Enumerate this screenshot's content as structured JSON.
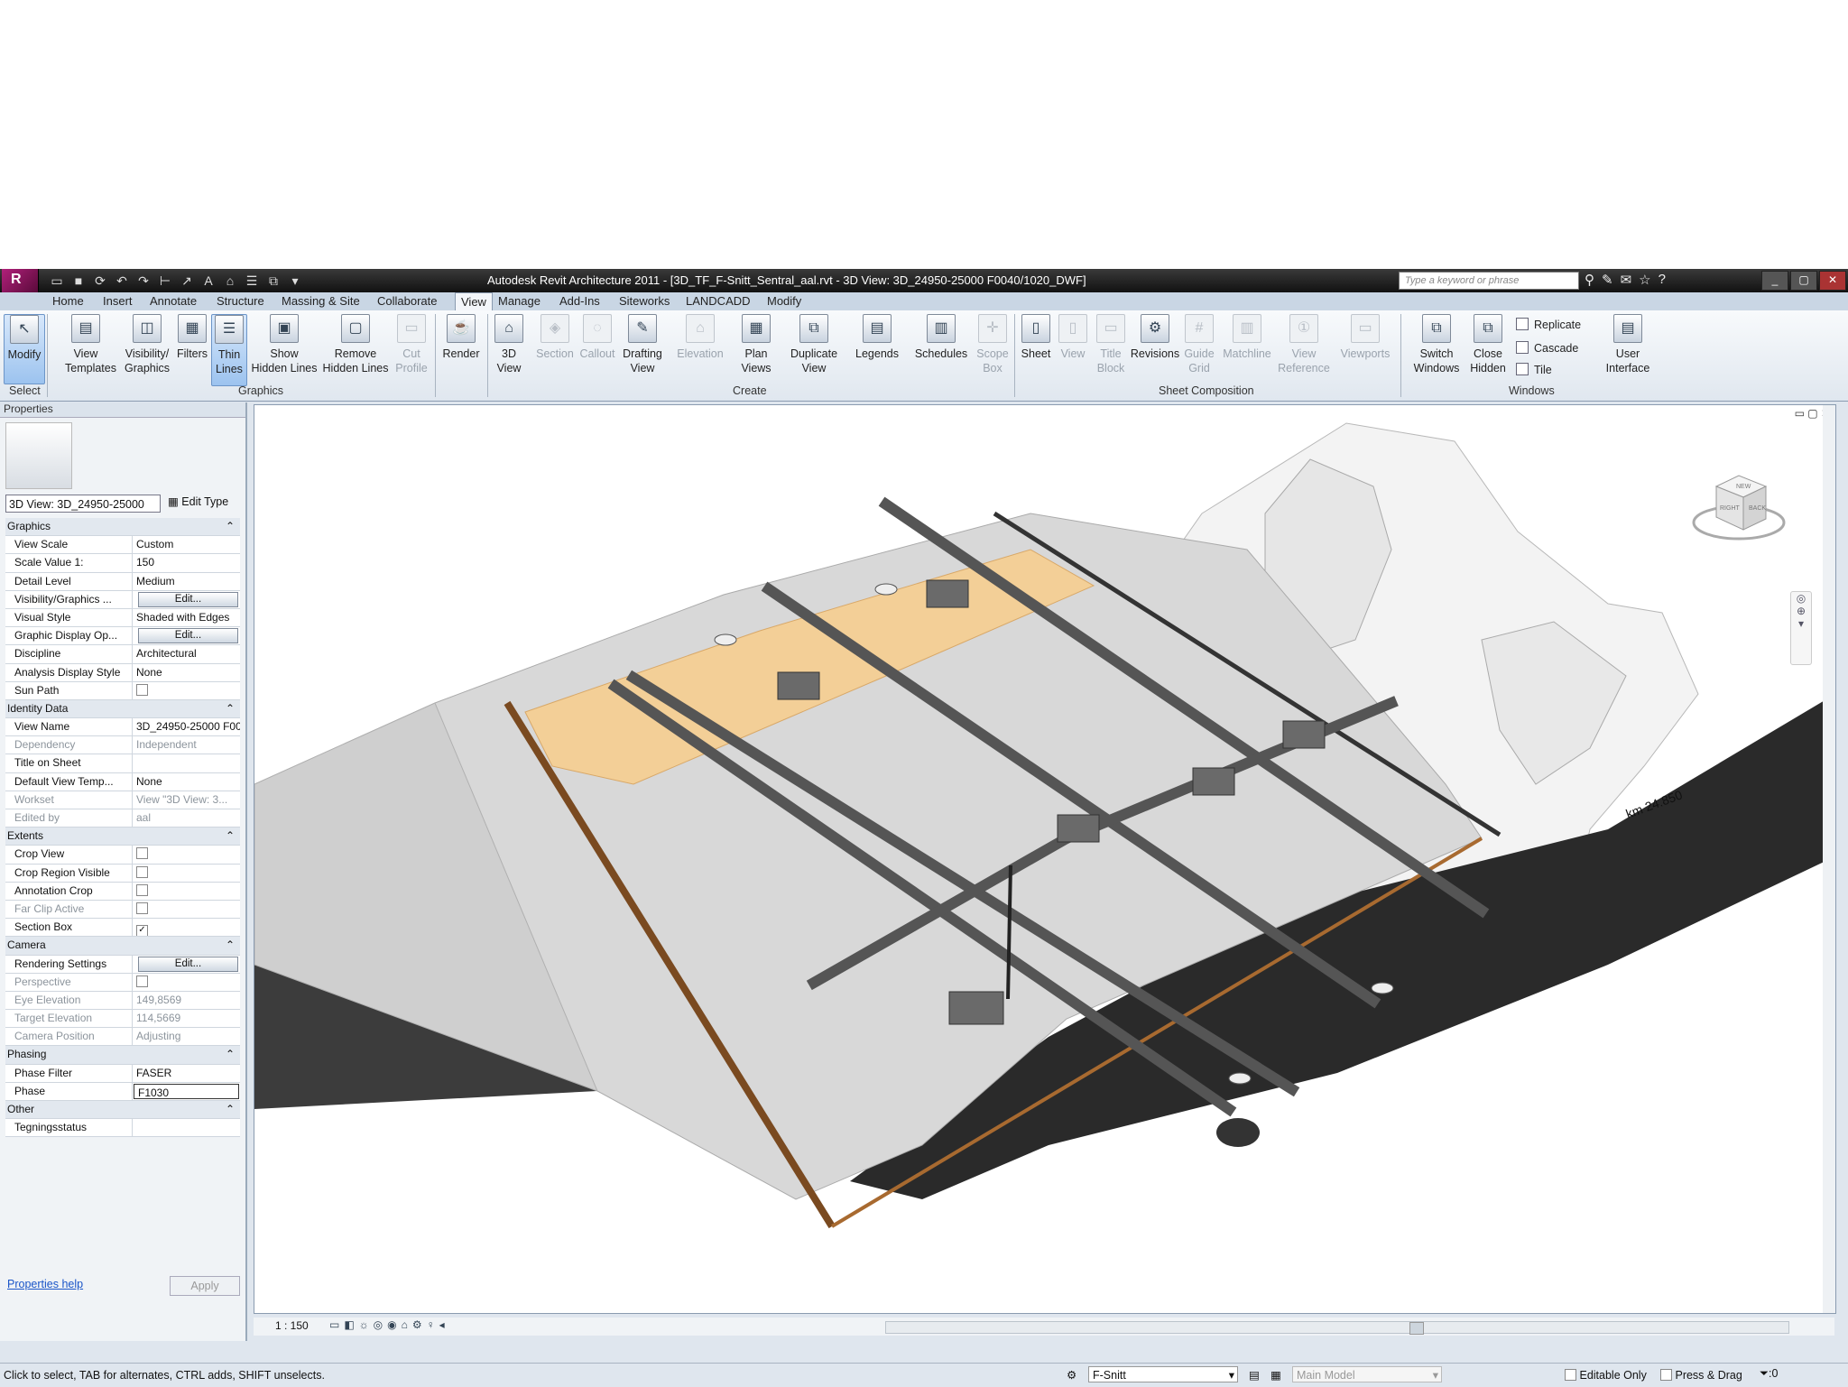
{
  "window": {
    "title": "Autodesk Revit Architecture 2011 - [3D_TF_F-Snitt_Sentral_aal.rvt - 3D View: 3D_24950-25000 F0040/1020_DWF]",
    "search_placeholder": "Type a keyword or phrase",
    "logo": "R"
  },
  "tabs": [
    "Home",
    "Insert",
    "Annotate",
    "Structure",
    "Massing & Site",
    "Collaborate",
    "View",
    "Manage",
    "Add-Ins",
    "Siteworks",
    "LANDCADD",
    "Modify"
  ],
  "active_tab": "View",
  "ribbon": {
    "modify": "Modify",
    "view_templates": [
      "View",
      "Templates"
    ],
    "visibility": [
      "Visibility/",
      "Graphics"
    ],
    "filters": "Filters",
    "thin_lines": [
      "Thin",
      "Lines"
    ],
    "show_hidden": [
      "Show",
      "Hidden Lines"
    ],
    "remove_hidden": [
      "Remove",
      "Hidden Lines"
    ],
    "cut_profile": [
      "Cut",
      "Profile"
    ],
    "render": "Render",
    "view3d": [
      "3D",
      "View"
    ],
    "section": "Section",
    "callout": "Callout",
    "drafting": [
      "Drafting",
      "View"
    ],
    "elevation": "Elevation",
    "plan_views": [
      "Plan",
      "Views"
    ],
    "duplicate": [
      "Duplicate",
      "View"
    ],
    "legends": "Legends",
    "schedules": "Schedules",
    "scope_box": [
      "Scope",
      "Box"
    ],
    "sheet": "Sheet",
    "view": "View",
    "title_block": [
      "Title",
      "Block"
    ],
    "revisions": "Revisions",
    "guide_grid": [
      "Guide",
      "Grid"
    ],
    "matchline": "Matchline",
    "view_reference": [
      "View",
      "Reference"
    ],
    "viewports": "Viewports",
    "switch_windows": [
      "Switch",
      "Windows"
    ],
    "close_hidden": [
      "Close",
      "Hidden"
    ],
    "replicate": "Replicate",
    "cascade": "Cascade",
    "tile": "Tile",
    "user_interface": [
      "User",
      "Interface"
    ],
    "groups": {
      "select": "Select",
      "graphics": "Graphics",
      "create": "Create",
      "sheet_composition": "Sheet Composition",
      "windows": "Windows"
    }
  },
  "properties": {
    "title": "Properties",
    "type_selector": "3D View: 3D_24950-25000",
    "edit_type": "Edit Type",
    "help": "Properties help",
    "apply": "Apply",
    "rows": [
      {
        "cat": "Graphics"
      },
      {
        "k": "View Scale",
        "v": "Custom"
      },
      {
        "k": "Scale Value    1:",
        "v": "150"
      },
      {
        "k": "Detail Level",
        "v": "Medium"
      },
      {
        "k": "Visibility/Graphics ...",
        "btn": "Edit..."
      },
      {
        "k": "Visual Style",
        "v": "Shaded with Edges"
      },
      {
        "k": "Graphic Display Op...",
        "btn": "Edit..."
      },
      {
        "k": "Discipline",
        "v": "Architectural"
      },
      {
        "k": "Analysis Display Style",
        "v": "None"
      },
      {
        "k": "Sun Path",
        "cb": ""
      },
      {
        "cat": "Identity Data"
      },
      {
        "k": "View Name",
        "v": "3D_24950-25000 F00..."
      },
      {
        "k": "Dependency",
        "v": "Independent",
        "grey": true
      },
      {
        "k": "Title on Sheet",
        "v": ""
      },
      {
        "k": "Default View Temp...",
        "v": "None"
      },
      {
        "k": "Workset",
        "v": "View \"3D View: 3...",
        "grey": true
      },
      {
        "k": "Edited by",
        "v": "aal",
        "grey": true
      },
      {
        "cat": "Extents"
      },
      {
        "k": "Crop View",
        "cb": ""
      },
      {
        "k": "Crop Region Visible",
        "cb": ""
      },
      {
        "k": "Annotation Crop",
        "cb": ""
      },
      {
        "k": "Far Clip Active",
        "cb": "",
        "grey": true
      },
      {
        "k": "Section Box",
        "cb": "✓"
      },
      {
        "cat": "Camera"
      },
      {
        "k": "Rendering Settings",
        "btn": "Edit..."
      },
      {
        "k": "Perspective",
        "cb": "",
        "grey": true
      },
      {
        "k": "Eye Elevation",
        "v": "149,8569",
        "grey": true
      },
      {
        "k": "Target Elevation",
        "v": "114,5669",
        "grey": true
      },
      {
        "k": "Camera Position",
        "v": "Adjusting",
        "grey": true
      },
      {
        "cat": "Phasing"
      },
      {
        "k": "Phase Filter",
        "v": "FASER"
      },
      {
        "k": "Phase",
        "v": "F1030",
        "edit": true
      },
      {
        "cat": "Other"
      },
      {
        "k": "Tegningsstatus",
        "v": ""
      }
    ]
  },
  "viewport": {
    "scale": "1 : 150",
    "station_label": "km 24.850",
    "viewcube": {
      "top": "NEW",
      "front": "RIGHT",
      "side": "BACK"
    }
  },
  "statusbar": {
    "message": "Click to select, TAB for alternates, CTRL adds, SHIFT unselects.",
    "workset": "F-Snitt",
    "design_option": "Main Model",
    "editable_only": "Editable Only",
    "press_drag": "Press & Drag",
    "filter_count": ":0"
  }
}
